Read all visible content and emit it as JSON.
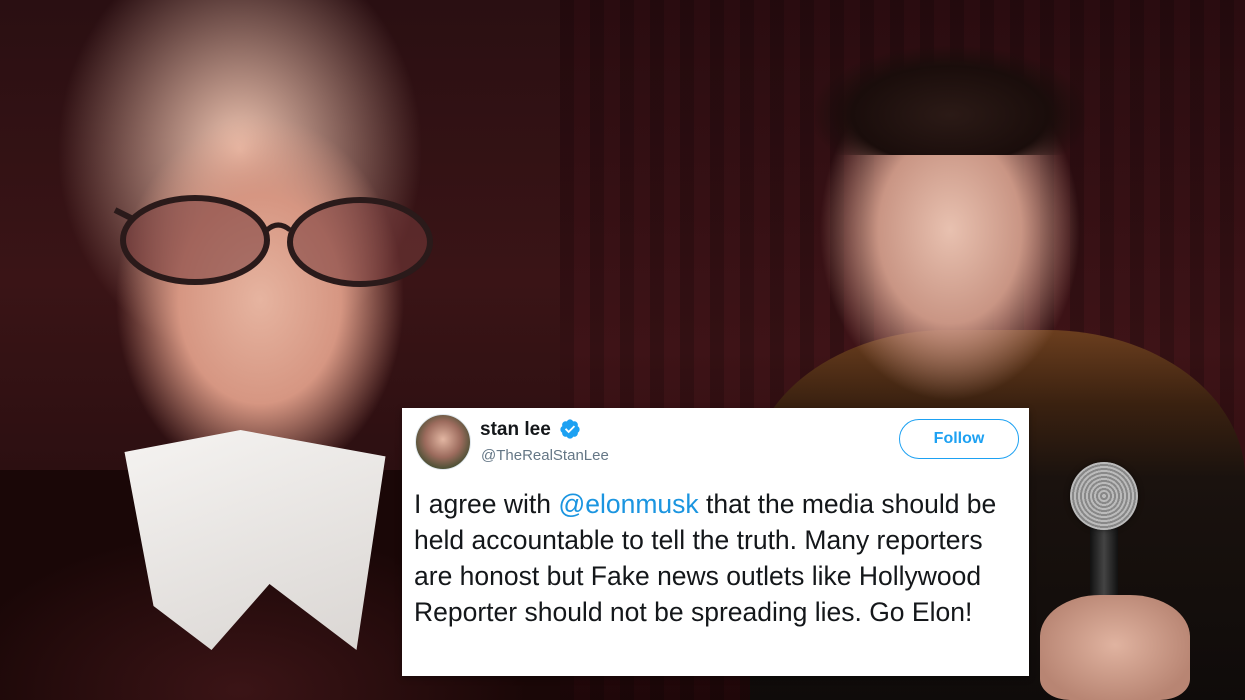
{
  "tweet": {
    "author_name": "stan lee",
    "author_handle": "@TheRealStanLee",
    "follow_label": "Follow",
    "text_before_mention": "I agree with ",
    "mention": "@elonmusk",
    "text_after_mention": " that the media should be held accountable to tell the truth. Many reporters are honost but Fake news outlets like Hollywood Reporter should not be spreading lies. Go Elon!",
    "verified": true,
    "icons": {
      "verified": "verified-badge-icon"
    }
  },
  "colors": {
    "link": "#1b95e0",
    "follow_accent": "#1da1f2",
    "text": "#14171a",
    "handle": "#657786",
    "card_background": "#ffffff"
  }
}
